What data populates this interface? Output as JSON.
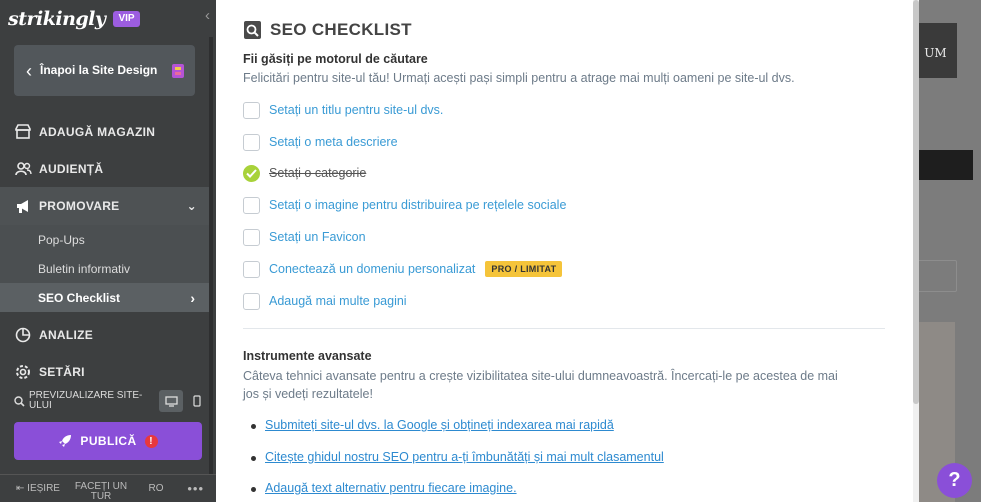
{
  "sidebar": {
    "logo": "strikingly",
    "vip": "VIP",
    "back_label": "Înapoi la Site Design",
    "nav": [
      {
        "label": "ADAUGĂ MAGAZIN"
      },
      {
        "label": "AUDIENȚĂ"
      },
      {
        "label": "PROMOVARE"
      },
      {
        "label": "ANALIZE"
      },
      {
        "label": "SETĂRI"
      }
    ],
    "sub_items": [
      "Pop-Ups",
      "Buletin informativ",
      "SEO Checklist"
    ],
    "preview_label": "PREVIZUALIZARE SITE-ULUI",
    "publish_label": "PUBLICĂ",
    "exit_label": "IEȘIRE",
    "tour_label": "FACEȚI UN TUR",
    "lang_label": "RO",
    "more_label": "•••"
  },
  "panel": {
    "title": "SEO CHECKLIST",
    "section1": {
      "heading": "Fii găsiți pe motorul de căutare",
      "desc": "Felicitări pentru site-ul tău! Urmați acești pași simpli pentru a atrage mai mulți oameni pe site-ul dvs."
    },
    "checklist": [
      {
        "label": "Setați un titlu pentru site-ul dvs.",
        "done": false
      },
      {
        "label": "Setați o meta descriere",
        "done": false
      },
      {
        "label": "Setați o categorie",
        "done": true
      },
      {
        "label": "Setați o imagine pentru distribuirea pe rețelele sociale",
        "done": false
      },
      {
        "label": "Setați un Favicon",
        "done": false
      },
      {
        "label": "Conectează un domeniu personalizat",
        "done": false,
        "badge": "PRO / LIMITAT"
      },
      {
        "label": "Adaugă mai multe pagini",
        "done": false
      }
    ],
    "section2": {
      "heading": "Instrumente avansate",
      "desc_line1": "Câteva tehnici avansate pentru a crește vizibilitatea site-ului dumneavoastră. Încercați-le pe acestea de mai",
      "desc_line2": "jos și vedeți rezultatele!"
    },
    "links": [
      "Submiteți site-ul dvs. la Google și obțineți indexarea mai rapidă",
      "Citește ghidul nostru SEO pentru a-ți îmbunătăți și mai mult clasamentul",
      "Adaugă text alternativ pentru fiecare imagine."
    ]
  },
  "background": {
    "fragment_text": "UM"
  },
  "help_label": "?",
  "colors": {
    "accent": "#8a4fd8",
    "link": "#3a9bd5",
    "check": "#a8d23a",
    "badge": "#f5c43a"
  }
}
